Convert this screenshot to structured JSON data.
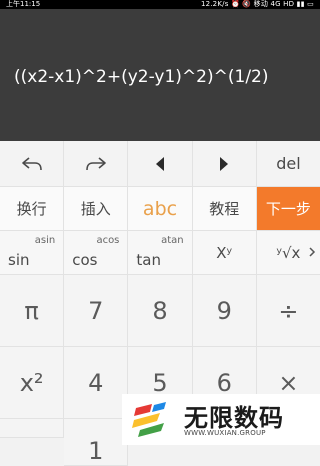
{
  "status_bar": {
    "time": "上午11:15",
    "right_text": "12.2K/s ⏰ 🔇 移动 4G HD ▮▮ ▭"
  },
  "display": {
    "expression": "((x2-x1)^2+(y2-y1)^2)^(1/2)"
  },
  "nav_row": {
    "undo_icon": "undo-icon",
    "redo_icon": "redo-icon",
    "left_icon": "cursor-left-icon",
    "right_icon": "cursor-right-icon",
    "del_label": "del"
  },
  "mode_row": {
    "newline": "换行",
    "insert": "插入",
    "abc": "abc",
    "tutorial": "教程",
    "next_step": "下一步"
  },
  "function_row": {
    "sin": "sin",
    "asin": "asin",
    "cos": "cos",
    "acos": "acos",
    "tan": "tan",
    "atan": "atan",
    "power": "Xʸ",
    "root": "ʸ√x",
    "more_icon": "chevron-right-icon"
  },
  "key_rows": {
    "row1": [
      "π",
      "7",
      "8",
      "9",
      "÷"
    ],
    "row2": [
      "x²",
      "4",
      "5",
      "6",
      "×"
    ],
    "row3": [
      "",
      "1",
      "",
      "",
      ""
    ]
  },
  "watermark": {
    "title": "无限数码",
    "subtitle": "WWW.WUXIAN.GROUP",
    "colors": [
      "#e53935",
      "#fbc02d",
      "#43a047",
      "#1e88e5"
    ]
  }
}
